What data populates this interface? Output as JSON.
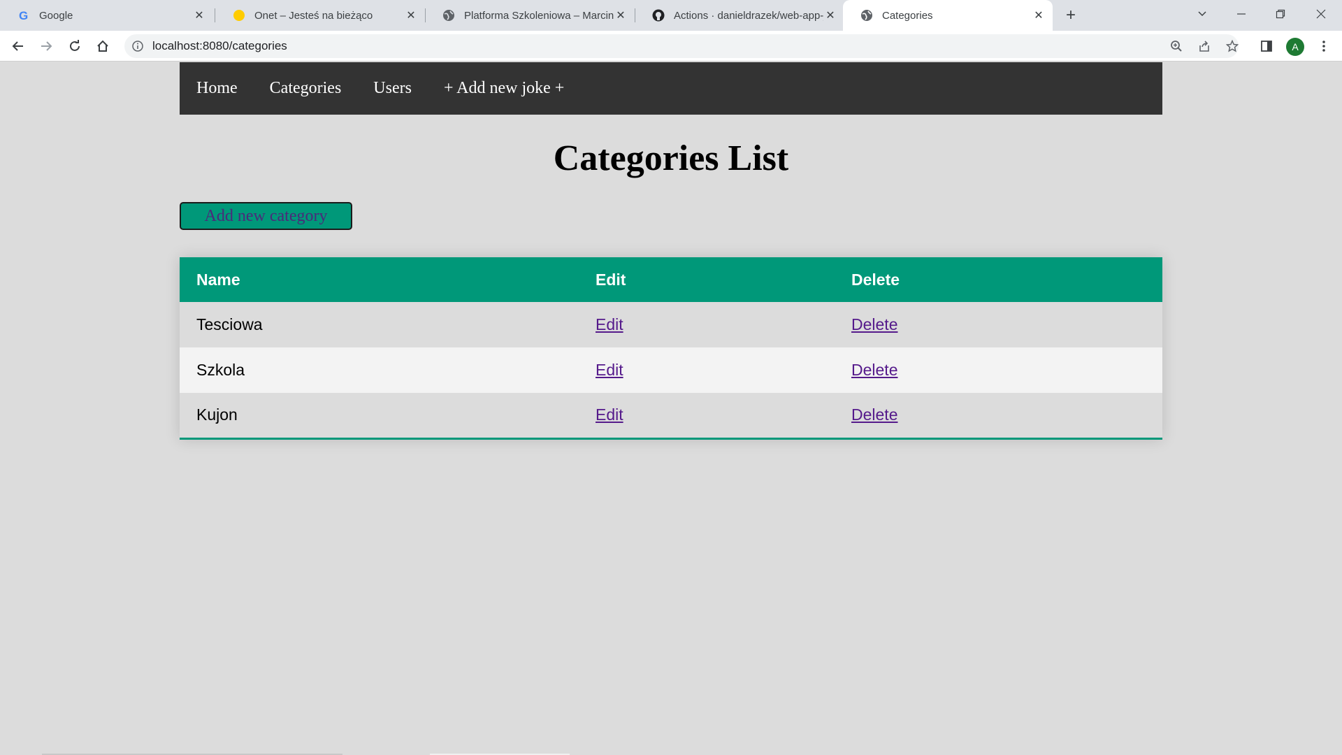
{
  "browser": {
    "tabs": [
      {
        "title": "Google",
        "favicon": "google-icon"
      },
      {
        "title": "Onet – Jesteś na bieżąco",
        "favicon": "onet-icon"
      },
      {
        "title": "Platforma Szkoleniowa – Marcin (",
        "favicon": "globe-icon"
      },
      {
        "title": "Actions · danieldrazek/web-app-j",
        "favicon": "github-icon"
      },
      {
        "title": "Categories",
        "favicon": "globe-icon",
        "active": true
      }
    ],
    "url": "localhost:8080/categories",
    "profile_initial": "A"
  },
  "nav": {
    "home": "Home",
    "categories": "Categories",
    "users": "Users",
    "add_joke": "+ Add new joke +"
  },
  "page": {
    "title": "Categories List",
    "add_button": "Add new category"
  },
  "table": {
    "headers": {
      "name": "Name",
      "edit": "Edit",
      "delete": "Delete"
    },
    "rows": [
      {
        "name": "Tesciowa",
        "edit": "Edit",
        "delete": "Delete"
      },
      {
        "name": "Szkola",
        "edit": "Edit",
        "delete": "Delete"
      },
      {
        "name": "Kujon",
        "edit": "Edit",
        "delete": "Delete"
      }
    ]
  },
  "colors": {
    "accent": "#009879",
    "navbar": "#333333",
    "background": "#dcdcdc",
    "link": "#551a8b"
  }
}
